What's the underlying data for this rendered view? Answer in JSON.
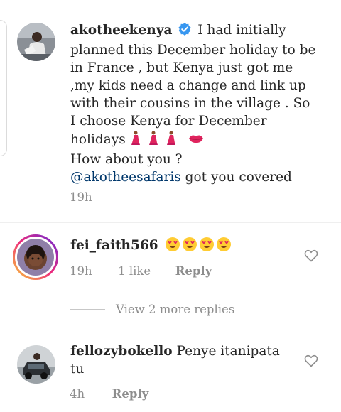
{
  "post": {
    "username": "akotheekenya",
    "caption": "I had initially planned this December holiday to be in France , but Kenya just got me ,my kids need a change and link up with their cousins in the village . So I choose Kenya for December holidays",
    "caption_tail": "How about you ?",
    "mention": "@akotheesafaris",
    "mention_suffix": "got you covered",
    "time": "19h",
    "verified_icon": "verified-badge-icon",
    "accent_color": "#3897f0"
  },
  "comments": [
    {
      "username": "fei_faith566",
      "text": "",
      "emoji": "heart-eyes-face x4",
      "time": "19h",
      "likes": "1 like",
      "reply_label": "Reply",
      "has_story_ring": true
    },
    {
      "username": "fellozybokello",
      "text": "Penye itanipata tu",
      "time": "4h",
      "reply_label": "Reply",
      "has_story_ring": false
    }
  ],
  "view_more_replies": "View 2 more replies"
}
